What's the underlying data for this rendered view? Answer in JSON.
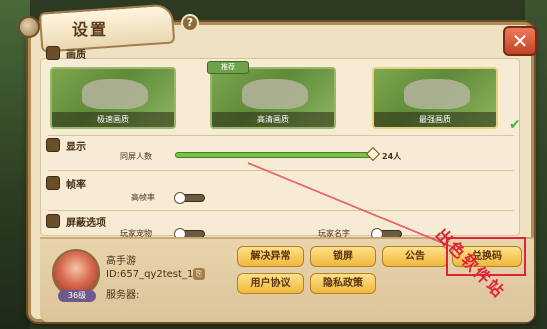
{
  "window": {
    "title": "设置",
    "help": "?",
    "close": "✕"
  },
  "sections": {
    "quality": {
      "label": "画质"
    },
    "display": {
      "label": "显示"
    },
    "framerate": {
      "label": "帧率"
    },
    "shield": {
      "label": "屏蔽选项"
    }
  },
  "quality_cards": [
    {
      "caption": "极速画质"
    },
    {
      "caption": "高清画质",
      "tag": "推荐"
    },
    {
      "caption": "最强画质",
      "selected": true
    }
  ],
  "display": {
    "same_screen_label": "同屏人数",
    "same_screen_value": "24人",
    "slider_fraction": 1.0
  },
  "framerate": {
    "high_fps_label": "高帧率",
    "enabled": false
  },
  "shield": {
    "pet_label": "玩家宠物",
    "name_label": "玩家名字"
  },
  "user": {
    "name": "高手游",
    "id": "ID:657_qy2test_1",
    "server": "服务器:",
    "level": "36级"
  },
  "buttons": {
    "fix": "解决异常",
    "lock": "锁屏",
    "notice": "公告",
    "redeem": "兑换码",
    "agreement": "用户协议",
    "privacy": "隐私政策"
  },
  "watermark": "出色软件站",
  "colors": {
    "accent": "#f0b93c",
    "highlight": "#e0223a"
  }
}
